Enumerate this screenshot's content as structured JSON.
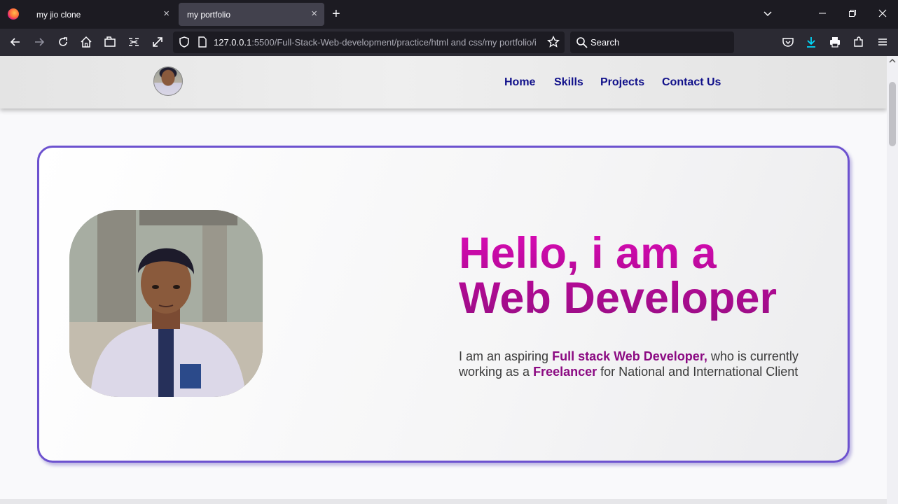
{
  "browser": {
    "tabs": [
      {
        "title": "my jio clone",
        "active": false
      },
      {
        "title": "my portfolio",
        "active": true
      }
    ],
    "new_tab_glyph": "+",
    "close_glyph": "×",
    "url_host": "127.0.0.1",
    "url_rest": ":5500/Full-Stack-Web-development/practice/html and css/my portfolio/i",
    "search_placeholder": "Search",
    "accent_download": "#00ddff",
    "icons": [
      "back-icon",
      "forward-icon",
      "reload-icon",
      "home-icon",
      "screenshot-icon",
      "tools-icon",
      "fullscreen-icon",
      "shield-icon",
      "page-icon",
      "bookmark-star-icon",
      "search-icon",
      "pocket-icon",
      "download-icon",
      "print-icon",
      "extensions-icon",
      "menu-icon"
    ]
  },
  "site": {
    "nav": [
      "Home",
      "Skills",
      "Projects",
      "Contact Us"
    ],
    "nav_color": "#10108a",
    "hero": {
      "heading_line1": "Hello, i am a",
      "heading_line2": "Web Developer",
      "intro_start": "I am an aspiring ",
      "role": "Full stack Web Developer,",
      "intro_mid": " who is currently working as a ",
      "job": "Freelancer",
      "intro_end": " for National and International Client",
      "heading_color": "#c40aa5",
      "border_color": "#6d52cf"
    }
  }
}
